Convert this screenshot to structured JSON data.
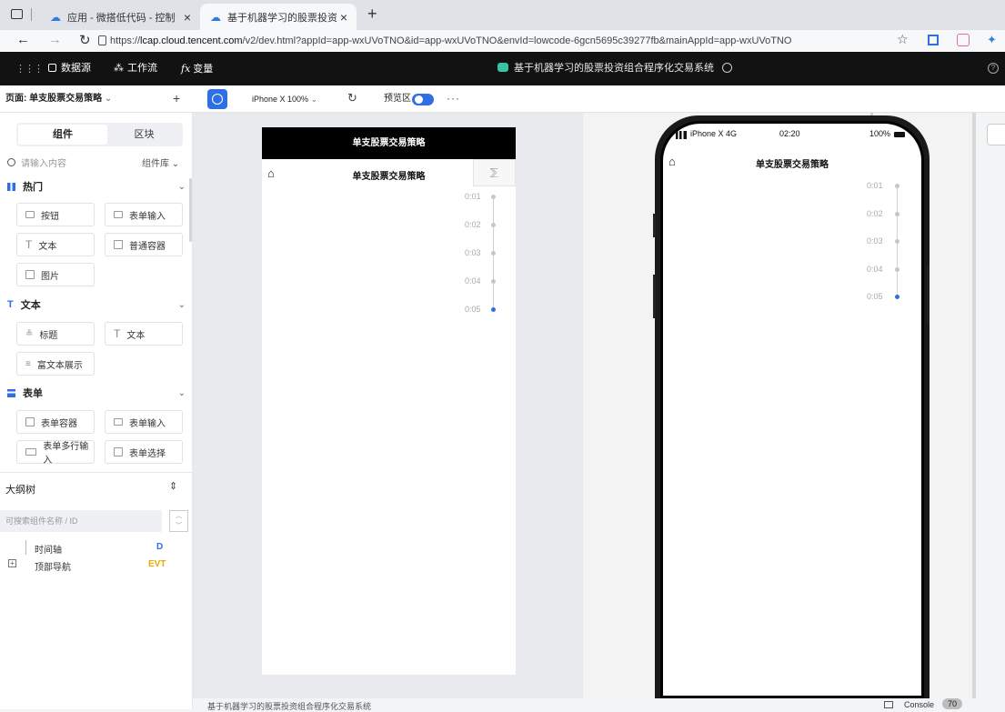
{
  "browser": {
    "tabs": [
      {
        "title": "应用 - 微搭低代码 - 控制台",
        "active": false
      },
      {
        "title": "基于机器学习的股票投资组合程",
        "active": true
      }
    ],
    "url_prefix": "https://",
    "url_domain": "lcap.cloud.tencent.com",
    "url_rest": "/v2/dev.html?appId=app-wxUVoTNO&id=app-wxUVoTNO&envId=lowcode-6gcn5695c39277fb&mainAppId=app-wxUVoTNO"
  },
  "topnav": {
    "items": [
      "数据源",
      "工作流",
      "变量"
    ],
    "fx": "fx",
    "app_title": "基于机器学习的股票投资组合程序化交易系统"
  },
  "toolbar": {
    "page_label": "页面: 单支股票交易策略",
    "device": "iPhone X 100%",
    "preview_label": "预览区"
  },
  "sidebar": {
    "tabs": [
      "组件",
      "区块"
    ],
    "search_placeholder": "请输入内容",
    "library_label": "组件库",
    "sections": [
      {
        "title": "热门",
        "items": [
          "按钮",
          "表单输入",
          "文本",
          "普通容器",
          "图片"
        ]
      },
      {
        "title": "文本",
        "items": [
          "标题",
          "文本",
          "富文本展示"
        ]
      },
      {
        "title": "表单",
        "items": [
          "表单容器",
          "表单输入",
          "表单多行输入",
          "表单选择"
        ]
      }
    ],
    "outline": {
      "title": "大纲树",
      "search_placeholder": "可搜索组件名称 / ID",
      "nodes": [
        {
          "label": "时间轴",
          "tag": "D"
        },
        {
          "label": "顶部导航",
          "tag": "EVT"
        }
      ]
    }
  },
  "canvas": {
    "header_title": "单支股票交易策略",
    "nav_title": "单支股票交易策略",
    "timeline": [
      "0:01",
      "0:02",
      "0:03",
      "0:04",
      "0:05"
    ]
  },
  "preview": {
    "status_carrier": "iPhone X 4G",
    "status_time": "02:20",
    "status_battery": "100%",
    "nav_title": "单支股票交易策略",
    "timeline": [
      "0:01",
      "0:02",
      "0:03",
      "0:04",
      "0:05"
    ]
  },
  "footer": {
    "app_name": "基于机器学习的股票投资组合程序化交易系统",
    "console_label": "Console",
    "console_count": "70"
  },
  "colors": {
    "accent": "#2f6fe4",
    "nav_bg": "#121212",
    "evt": "#f0a800"
  }
}
